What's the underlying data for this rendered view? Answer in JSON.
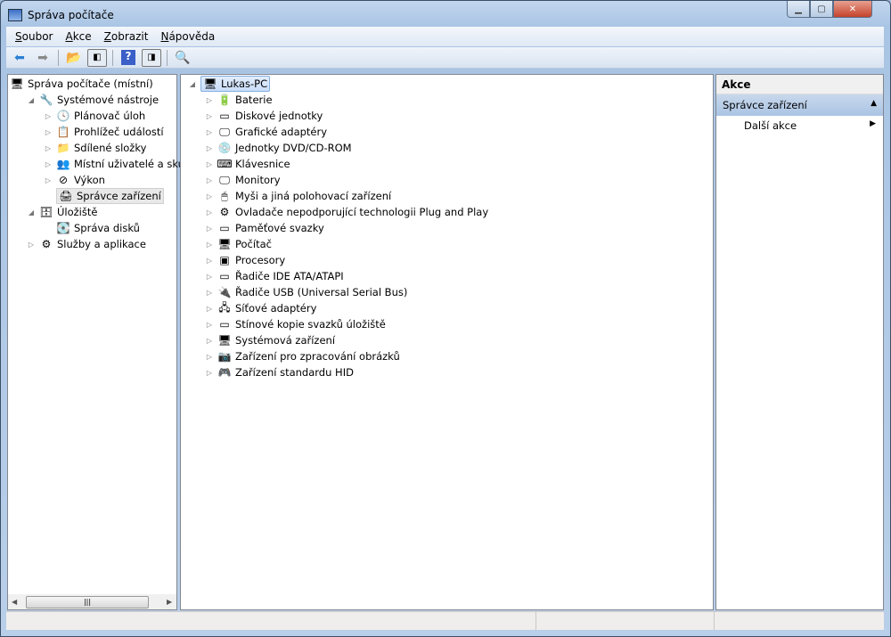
{
  "window": {
    "title": "Správa počítače",
    "controls": [
      "minimize",
      "maximize",
      "close"
    ]
  },
  "menu": [
    {
      "label": "Soubor",
      "key": "S",
      "rest": "oubor"
    },
    {
      "label": "Akce",
      "key": "A",
      "rest": "kce"
    },
    {
      "label": "Zobrazit",
      "key": "Z",
      "rest": "obrazit"
    },
    {
      "label": "Nápověda",
      "key": "N",
      "rest": "ápověda"
    }
  ],
  "toolbar": [
    "back-arrow-icon",
    "forward-arrow-icon",
    "up-folder-icon",
    "show-hide-tree-icon",
    "help-icon",
    "show-hide-action-pane-icon",
    "scan-hardware-icon"
  ],
  "left_tree": [
    {
      "label": "Správa počítače (místní)",
      "level": 0,
      "exp": "",
      "icon": "🖥"
    },
    {
      "label": "Systémové nástroje",
      "level": 1,
      "exp": "◢",
      "icon": "🔧"
    },
    {
      "label": "Plánovač úloh",
      "level": 2,
      "exp": "▷",
      "icon": "🕓"
    },
    {
      "label": "Prohlížeč událostí",
      "level": 2,
      "exp": "▷",
      "icon": "📋"
    },
    {
      "label": "Sdílené složky",
      "level": 2,
      "exp": "▷",
      "icon": "📁"
    },
    {
      "label": "Místní uživatelé a skupiny",
      "level": 2,
      "exp": "▷",
      "icon": "👥"
    },
    {
      "label": "Výkon",
      "level": 2,
      "exp": "▷",
      "icon": "⊘"
    },
    {
      "label": "Správce zařízení",
      "level": 2,
      "exp": "",
      "icon": "🖨",
      "selected": true
    },
    {
      "label": "Úložiště",
      "level": 1,
      "exp": "◢",
      "icon": "🗄"
    },
    {
      "label": "Správa disků",
      "level": 2,
      "exp": "",
      "icon": "💽"
    },
    {
      "label": "Služby a aplikace",
      "level": 1,
      "exp": "▷",
      "icon": "⚙"
    }
  ],
  "device_tree": {
    "root": "Lukas-PC",
    "items": [
      {
        "label": "Baterie",
        "icon": "🔋"
      },
      {
        "label": "Diskové jednotky",
        "icon": "▭"
      },
      {
        "label": "Grafické adaptéry",
        "icon": "🖵"
      },
      {
        "label": "Jednotky DVD/CD-ROM",
        "icon": "💿"
      },
      {
        "label": "Klávesnice",
        "icon": "⌨"
      },
      {
        "label": "Monitory",
        "icon": "🖵"
      },
      {
        "label": "Myši a jiná polohovací zařízení",
        "icon": "🖱"
      },
      {
        "label": "Ovladače nepodporující technologii Plug and Play",
        "icon": "⚙"
      },
      {
        "label": "Paměťové svazky",
        "icon": "▭"
      },
      {
        "label": "Počítač",
        "icon": "🖥"
      },
      {
        "label": "Procesory",
        "icon": "▣"
      },
      {
        "label": "Řadiče IDE ATA/ATAPI",
        "icon": "▭"
      },
      {
        "label": "Řadiče USB (Universal Serial Bus)",
        "icon": "🔌"
      },
      {
        "label": "Síťové adaptéry",
        "icon": "🖧"
      },
      {
        "label": "Stínové kopie svazků úložiště",
        "icon": "▭"
      },
      {
        "label": "Systémová zařízení",
        "icon": "🖥"
      },
      {
        "label": "Zařízení pro zpracování obrázků",
        "icon": "📷"
      },
      {
        "label": "Zařízení standardu HID",
        "icon": "🎮"
      }
    ]
  },
  "actions": {
    "header": "Akce",
    "section": "Správce zařízení",
    "items": [
      "Další akce"
    ]
  },
  "colors": {
    "selection": "#c9defa",
    "action_section": "#b8cde8",
    "frame": "#b9cfe9"
  }
}
